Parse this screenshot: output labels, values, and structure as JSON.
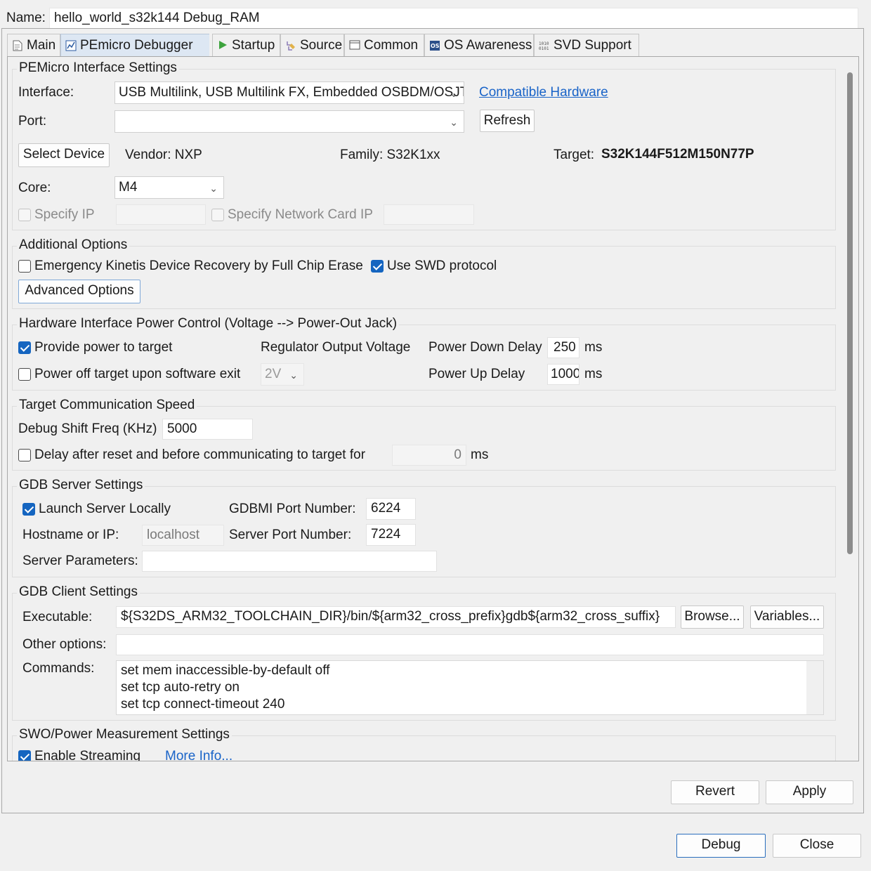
{
  "name_row": {
    "label": "Name:",
    "value": "hello_world_s32k144 Debug_RAM"
  },
  "tabs": [
    {
      "label": "Main",
      "icon": "page-icon"
    },
    {
      "label": "PEmicro Debugger",
      "icon": "pemicro-icon"
    },
    {
      "label": "Startup",
      "icon": "play-icon"
    },
    {
      "label": "Source",
      "icon": "source-icon"
    },
    {
      "label": "Common",
      "icon": "common-icon"
    },
    {
      "label": "OS Awareness",
      "icon": "os-icon"
    },
    {
      "label": "SVD Support",
      "icon": "svd-icon"
    }
  ],
  "interface_settings": {
    "title": "PEMicro Interface Settings",
    "interface_label": "Interface:",
    "interface_value": "USB Multilink, USB Multilink FX, Embedded OSBDM/OSJTAG - USB Port",
    "compatible_hw": "Compatible Hardware",
    "port_label": "Port:",
    "port_value": "",
    "refresh": "Refresh",
    "select_device": "Select Device",
    "vendor": "Vendor: NXP",
    "family": "Family: S32K1xx",
    "target_label": "Target:",
    "target_value": "S32K144F512M150N77P",
    "core_label": "Core:",
    "core_value": "M4",
    "specify_ip": "Specify IP",
    "specify_net": "Specify Network Card IP"
  },
  "additional_options": {
    "title": "Additional Options",
    "emergency": "Emergency Kinetis Device Recovery by Full Chip Erase",
    "emergency_checked": false,
    "swd": "Use SWD protocol",
    "swd_checked": true,
    "advanced": "Advanced Options"
  },
  "power_control": {
    "title": "Hardware Interface Power Control (Voltage --> Power-Out Jack)",
    "provide_power": "Provide power to target",
    "provide_power_checked": true,
    "power_off": "Power off target upon software exit",
    "power_off_checked": false,
    "regulator_label": "Regulator Output Voltage",
    "regulator_value": "2V",
    "down_delay_label": "Power Down Delay",
    "down_delay_value": "250",
    "up_delay_label": "Power Up Delay",
    "up_delay_value": "1000",
    "ms": "ms"
  },
  "comm_speed": {
    "title": "Target Communication Speed",
    "freq_label": "Debug Shift Freq (KHz)",
    "freq_value": "5000",
    "delay_label": "Delay after reset and before communicating to target for",
    "delay_checked": false,
    "delay_value": "0",
    "ms": "ms"
  },
  "gdb_server": {
    "title": "GDB Server Settings",
    "launch": "Launch Server Locally",
    "launch_checked": true,
    "gdbmi_label": "GDBMI Port Number:",
    "gdbmi_value": "6224",
    "host_label": "Hostname or IP:",
    "host_value": "localhost",
    "server_port_label": "Server Port Number:",
    "server_port_value": "7224",
    "params_label": "Server Parameters:",
    "params_value": ""
  },
  "gdb_client": {
    "title": "GDB Client Settings",
    "exe_label": "Executable:",
    "exe_value": "${S32DS_ARM32_TOOLCHAIN_DIR}/bin/${arm32_cross_prefix}gdb${arm32_cross_suffix}",
    "browse": "Browse...",
    "variables": "Variables...",
    "other_label": "Other options:",
    "other_value": "",
    "commands_label": "Commands:",
    "commands": [
      "set mem inaccessible-by-default off",
      "set tcp auto-retry on",
      "set tcp connect-timeout 240"
    ]
  },
  "swo": {
    "title": "SWO/Power Measurement Settings",
    "enable": "Enable Streaming",
    "enable_checked": true,
    "more_info": "More Info..."
  },
  "footer": {
    "revert": "Revert",
    "apply": "Apply",
    "debug": "Debug",
    "close": "Close"
  }
}
